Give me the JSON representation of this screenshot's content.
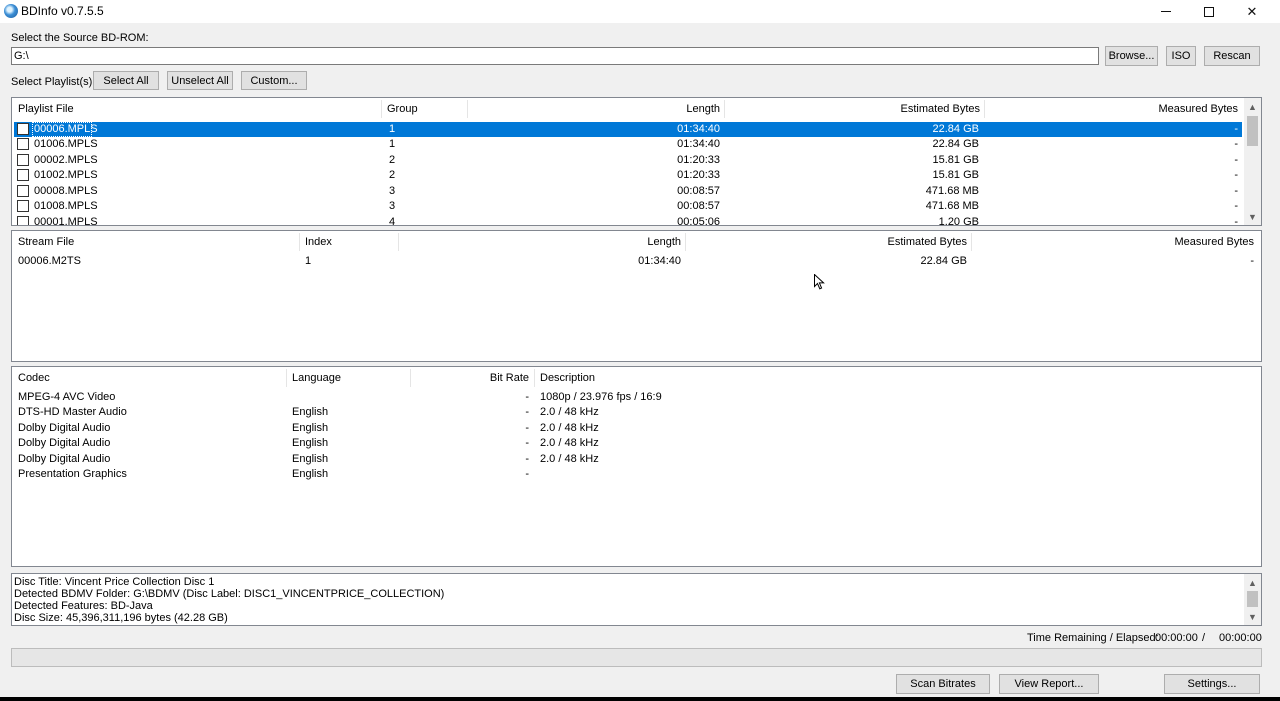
{
  "window": {
    "title": "BDInfo v0.7.5.5"
  },
  "source": {
    "label": "Select the Source BD-ROM:",
    "path": "G:\\",
    "browse_label": "Browse...",
    "iso_label": "ISO",
    "rescan_label": "Rescan"
  },
  "playlist_select": {
    "label": "Select Playlist(s):",
    "select_all_label": "Select All",
    "unselect_all_label": "Unselect All",
    "custom_label": "Custom..."
  },
  "playlists": {
    "headers": [
      "Playlist File",
      "Group",
      "Length",
      "Estimated Bytes",
      "Measured Bytes"
    ],
    "rows": [
      {
        "file": "00006.MPLS",
        "group": "1",
        "length": "01:34:40",
        "est": "22.84 GB",
        "measured": "-",
        "selected": true
      },
      {
        "file": "01006.MPLS",
        "group": "1",
        "length": "01:34:40",
        "est": "22.84 GB",
        "measured": "-"
      },
      {
        "file": "00002.MPLS",
        "group": "2",
        "length": "01:20:33",
        "est": "15.81 GB",
        "measured": "-"
      },
      {
        "file": "01002.MPLS",
        "group": "2",
        "length": "01:20:33",
        "est": "15.81 GB",
        "measured": "-"
      },
      {
        "file": "00008.MPLS",
        "group": "3",
        "length": "00:08:57",
        "est": "471.68 MB",
        "measured": "-"
      },
      {
        "file": "01008.MPLS",
        "group": "3",
        "length": "00:08:57",
        "est": "471.68 MB",
        "measured": "-"
      },
      {
        "file": "00001.MPLS",
        "group": "4",
        "length": "00:05:06",
        "est": "1.20 GB",
        "measured": "-"
      }
    ]
  },
  "streams": {
    "headers": [
      "Stream File",
      "Index",
      "Length",
      "Estimated Bytes",
      "Measured Bytes"
    ],
    "rows": [
      {
        "file": "00006.M2TS",
        "index": "1",
        "length": "01:34:40",
        "est": "22.84 GB",
        "measured": "-"
      }
    ]
  },
  "codecs": {
    "headers": [
      "Codec",
      "Language",
      "Bit Rate",
      "Description"
    ],
    "rows": [
      {
        "codec": "MPEG-4 AVC Video",
        "language": "",
        "bitrate": "-",
        "desc": "1080p / 23.976 fps / 16:9"
      },
      {
        "codec": "DTS-HD Master Audio",
        "language": "English",
        "bitrate": "-",
        "desc": "2.0 / 48 kHz"
      },
      {
        "codec": "Dolby Digital Audio",
        "language": "English",
        "bitrate": "-",
        "desc": "2.0 / 48 kHz"
      },
      {
        "codec": "Dolby Digital Audio",
        "language": "English",
        "bitrate": "-",
        "desc": "2.0 / 48 kHz"
      },
      {
        "codec": "Dolby Digital Audio",
        "language": "English",
        "bitrate": "-",
        "desc": "2.0 / 48 kHz"
      },
      {
        "codec": "Presentation Graphics",
        "language": "English",
        "bitrate": "-",
        "desc": ""
      }
    ]
  },
  "log": [
    "Disc Title: Vincent Price Collection Disc 1",
    "Detected BDMV Folder: G:\\BDMV (Disc Label: DISC1_VINCENTPRICE_COLLECTION)",
    "Detected Features: BD-Java",
    "Disc Size: 45,396,311,196 bytes (42.28 GB)"
  ],
  "status": {
    "time_label": "Time Remaining / Elapsed:",
    "remaining": "00:00:00",
    "separator": "/",
    "elapsed": "00:00:00",
    "progress": 0
  },
  "actions": {
    "scan_label": "Scan Bitrates",
    "report_label": "View Report...",
    "settings_label": "Settings..."
  },
  "colors": {
    "selection": "#0078d7",
    "progress": "#06b025"
  }
}
